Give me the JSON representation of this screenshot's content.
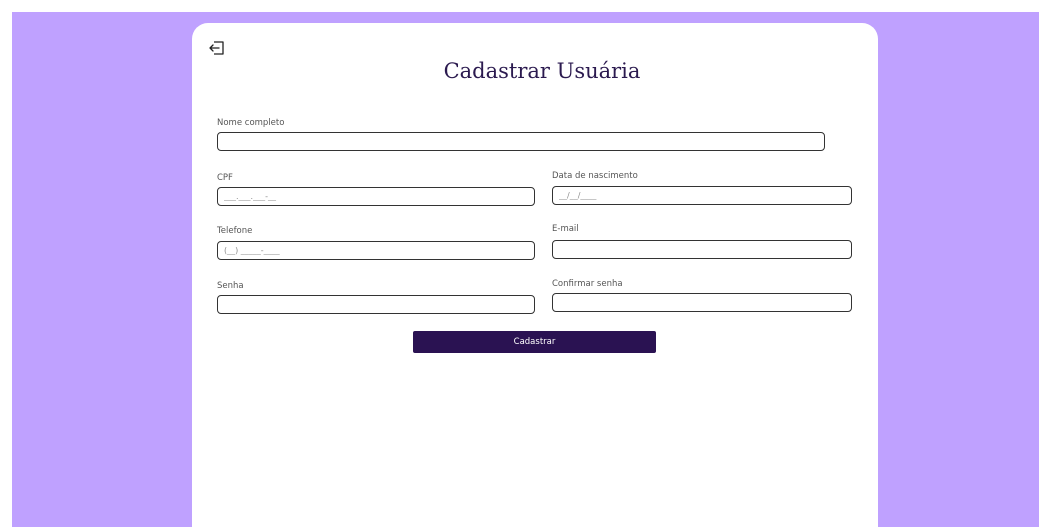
{
  "page": {
    "title": "Cadastrar Usuária",
    "back_icon": "logout-arrow-icon",
    "colors": {
      "background": "#bfa1ff",
      "card": "#ffffff",
      "title": "#2b1a4f",
      "button": "#2a1252",
      "button_text": "#ffffff"
    }
  },
  "form": {
    "nome": {
      "label": "Nome completo",
      "value": "",
      "placeholder": ""
    },
    "cpf": {
      "label": "CPF",
      "value": "",
      "placeholder": "___.___.___-__"
    },
    "nascimento": {
      "label": "Data de nascimento",
      "value": "",
      "placeholder": "__/__/____"
    },
    "telefone": {
      "label": "Telefone",
      "value": "",
      "placeholder": "(__) _____-____"
    },
    "email": {
      "label": "E-mail",
      "value": "",
      "placeholder": ""
    },
    "senha": {
      "label": "Senha",
      "value": "",
      "placeholder": ""
    },
    "confirmar_senha": {
      "label": "Confirmar senha",
      "value": "",
      "placeholder": ""
    },
    "submit_label": "Cadastrar"
  }
}
